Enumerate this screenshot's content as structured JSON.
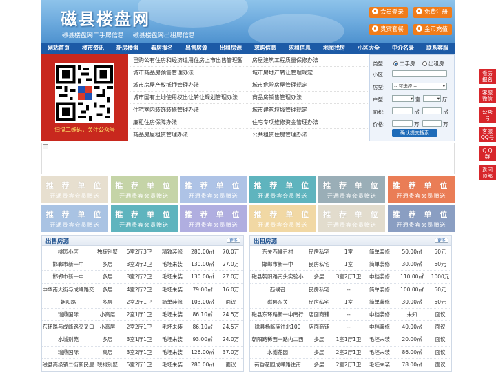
{
  "site": {
    "title": "磁县楼盘网",
    "sub_links": [
      "磁县楼盘网二手房信息",
      "磁县楼盘网出租房信息"
    ]
  },
  "header_buttons": {
    "login": "会员登录",
    "register": "免费注册",
    "vip": "贵宾套餐",
    "recharge": "金币充值"
  },
  "nav": [
    "网站首页",
    "楼市资讯",
    "新房楼盘",
    "看房报名",
    "出售房源",
    "出租房源",
    "求购信息",
    "求租信息",
    "地图找房",
    "小区大全",
    "中介名录",
    "联系客服"
  ],
  "qr_caption": "扫描二维码，关注公众号",
  "policy_links": [
    [
      "已购公有住房和经济适用住房上市出售管理暂",
      "房屋建筑工程质量保修办法"
    ],
    [
      "城市商品房预售管理办法",
      "城市房地产转让管理规定"
    ],
    [
      "城市房屋产权抵押管理办法",
      "城市危险房屋管理规定"
    ],
    [
      "城市国有土地使用权出让转让规划管理办法",
      "商品房销售管理办法"
    ],
    [
      "住宅室内装饰装修管理办法",
      "城市建筑垃圾管理规定"
    ],
    [
      "廉租住房保障办法",
      "住宅专项维修资金管理办法"
    ],
    [
      "商品房屋租赁管理办法",
      "公共租赁住房管理办法"
    ]
  ],
  "search": {
    "type_label": "类型:",
    "opt_second": "二手房",
    "opt_rent": "出租房",
    "community_label": "小区:",
    "housetype_label": "房型:",
    "housetype_value": "-- 可选择 --",
    "layout_label": "户型:",
    "room_unit": "室",
    "hall_unit": "厅",
    "area_label": "面积:",
    "area_unit": "㎡",
    "price_label": "价格:",
    "price_unit": "万",
    "submit": "确认提交搜索"
  },
  "ads": {
    "line1": "推 荐 单 位",
    "line2": "开通贵宾会员赠送",
    "colors": [
      "#e7dfcf",
      "#c5d4a7",
      "#aec3e6",
      "#5fb4be",
      "#9aaeb7",
      "#ea7d56",
      "#a9c3e3",
      "#5fb4be",
      "#b0aee0",
      "#f1d8a4",
      "#e2dccd",
      "#8a9ec2"
    ]
  },
  "sale": {
    "title": "出售房源",
    "more": "更多",
    "rows": [
      [
        "桃园小区",
        "独栋别墅",
        "5室2厅3卫",
        "精致装修",
        "280.00㎡",
        "70.0万"
      ],
      [
        "邯郸市新一中",
        "多层",
        "3室2厅2卫",
        "毛坯未装",
        "130.00㎡",
        "27.0万"
      ],
      [
        "邯郸市新一中",
        "多层",
        "3室2厅2卫",
        "毛坯未装",
        "130.00㎡",
        "27.0万"
      ],
      [
        "中华南大街与成峰路交",
        "多层",
        "4室2厅2卫",
        "毛坯未装",
        "79.00㎡",
        "16.0万"
      ],
      [
        "朝阳路",
        "多层",
        "2室2厅1卫",
        "简单装修",
        "103.00㎡",
        "面议"
      ],
      [
        "瑞鼎国际",
        "小高层",
        "2室1厅1卫",
        "毛坯未装",
        "86.10㎡",
        "24.5万"
      ],
      [
        "东环路与成峰路交叉口",
        "小高层",
        "2室2厅1卫",
        "毛坯未装",
        "86.10㎡",
        "24.5万"
      ],
      [
        "水城别苑",
        "多层",
        "3室1厅1卫",
        "毛坯未装",
        "93.00㎡",
        "24.0万"
      ],
      [
        "瑞鼎国际",
        "高层",
        "3室2厅1卫",
        "毛坯未装",
        "126.00㎡",
        "37.0万"
      ],
      [
        "磁县高级镇二街新民居",
        "联排别墅",
        "5室2厅1卫",
        "毛坯未装",
        "280.00㎡",
        "面议"
      ]
    ]
  },
  "rent": {
    "title": "出租房源",
    "more": "更多",
    "rows": [
      [
        "东关西候召村",
        "民房私宅",
        "1室",
        "简单装修",
        "50.00㎡",
        "50元"
      ],
      [
        "邯郸市新一中",
        "民房私宅",
        "1室",
        "简单装修",
        "30.00㎡",
        "50元"
      ],
      [
        "磁县朝阳路南头实验小",
        "多层",
        "3室2厅1卫",
        "中档装修",
        "110.00㎡",
        "1000元"
      ],
      [
        "西候召",
        "民房私宅",
        "--",
        "简单装修",
        "100.00㎡",
        "50元"
      ],
      [
        "磁县东关",
        "民房私宅",
        "1室",
        "简单装修",
        "30.00㎡",
        "50元"
      ],
      [
        "磁县东环路新一中南行",
        "店面商铺",
        "--",
        "中档装修",
        "未知",
        "面议"
      ],
      [
        "磁县杨临庙往北100",
        "店面商铺",
        "--",
        "中档装修",
        "40.00㎡",
        "面议"
      ],
      [
        "朝阳路稀西一路内二西",
        "多层",
        "1室1厅1卫",
        "毛坯未装",
        "20.00㎡",
        "面议"
      ],
      [
        "水榭花园",
        "多层",
        "2室2厅1卫",
        "毛坯未装",
        "86.00㎡",
        "面议"
      ],
      [
        "荷香花园成峰路往南",
        "多层",
        "2室2厅1卫",
        "毛坯未装",
        "78.00㎡",
        "面议"
      ]
    ]
  },
  "side_buttons": [
    [
      "看房",
      "报名"
    ],
    [
      "客服",
      "微信"
    ],
    [
      "公众",
      "号"
    ],
    [
      "客服",
      "QQ号"
    ],
    [
      "Q Q",
      "群"
    ],
    [
      "返回",
      "顶部"
    ]
  ]
}
